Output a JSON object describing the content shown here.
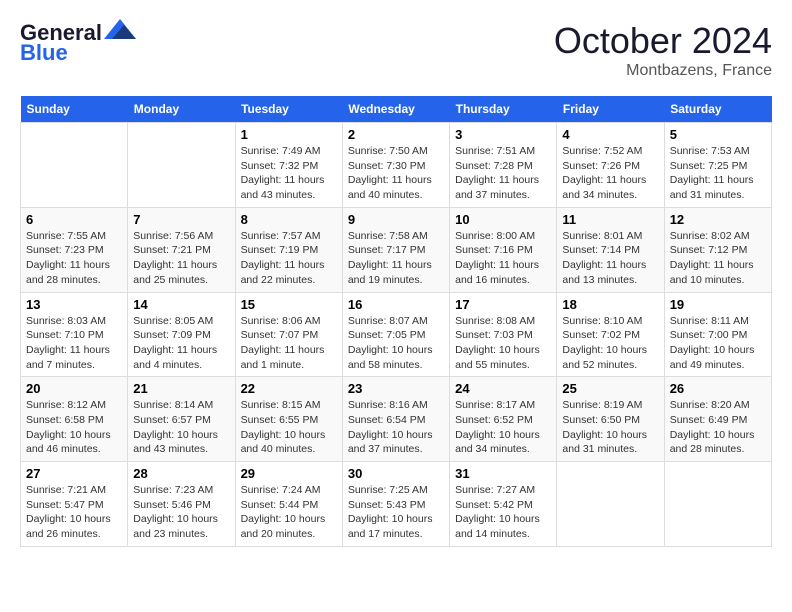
{
  "header": {
    "logo_line1": "General",
    "logo_line2": "Blue",
    "month": "October 2024",
    "location": "Montbazens, France"
  },
  "weekdays": [
    "Sunday",
    "Monday",
    "Tuesday",
    "Wednesday",
    "Thursday",
    "Friday",
    "Saturday"
  ],
  "weeks": [
    [
      {
        "day": "",
        "info": ""
      },
      {
        "day": "",
        "info": ""
      },
      {
        "day": "1",
        "info": "Sunrise: 7:49 AM\nSunset: 7:32 PM\nDaylight: 11 hours and 43 minutes."
      },
      {
        "day": "2",
        "info": "Sunrise: 7:50 AM\nSunset: 7:30 PM\nDaylight: 11 hours and 40 minutes."
      },
      {
        "day": "3",
        "info": "Sunrise: 7:51 AM\nSunset: 7:28 PM\nDaylight: 11 hours and 37 minutes."
      },
      {
        "day": "4",
        "info": "Sunrise: 7:52 AM\nSunset: 7:26 PM\nDaylight: 11 hours and 34 minutes."
      },
      {
        "day": "5",
        "info": "Sunrise: 7:53 AM\nSunset: 7:25 PM\nDaylight: 11 hours and 31 minutes."
      }
    ],
    [
      {
        "day": "6",
        "info": "Sunrise: 7:55 AM\nSunset: 7:23 PM\nDaylight: 11 hours and 28 minutes."
      },
      {
        "day": "7",
        "info": "Sunrise: 7:56 AM\nSunset: 7:21 PM\nDaylight: 11 hours and 25 minutes."
      },
      {
        "day": "8",
        "info": "Sunrise: 7:57 AM\nSunset: 7:19 PM\nDaylight: 11 hours and 22 minutes."
      },
      {
        "day": "9",
        "info": "Sunrise: 7:58 AM\nSunset: 7:17 PM\nDaylight: 11 hours and 19 minutes."
      },
      {
        "day": "10",
        "info": "Sunrise: 8:00 AM\nSunset: 7:16 PM\nDaylight: 11 hours and 16 minutes."
      },
      {
        "day": "11",
        "info": "Sunrise: 8:01 AM\nSunset: 7:14 PM\nDaylight: 11 hours and 13 minutes."
      },
      {
        "day": "12",
        "info": "Sunrise: 8:02 AM\nSunset: 7:12 PM\nDaylight: 11 hours and 10 minutes."
      }
    ],
    [
      {
        "day": "13",
        "info": "Sunrise: 8:03 AM\nSunset: 7:10 PM\nDaylight: 11 hours and 7 minutes."
      },
      {
        "day": "14",
        "info": "Sunrise: 8:05 AM\nSunset: 7:09 PM\nDaylight: 11 hours and 4 minutes."
      },
      {
        "day": "15",
        "info": "Sunrise: 8:06 AM\nSunset: 7:07 PM\nDaylight: 11 hours and 1 minute."
      },
      {
        "day": "16",
        "info": "Sunrise: 8:07 AM\nSunset: 7:05 PM\nDaylight: 10 hours and 58 minutes."
      },
      {
        "day": "17",
        "info": "Sunrise: 8:08 AM\nSunset: 7:03 PM\nDaylight: 10 hours and 55 minutes."
      },
      {
        "day": "18",
        "info": "Sunrise: 8:10 AM\nSunset: 7:02 PM\nDaylight: 10 hours and 52 minutes."
      },
      {
        "day": "19",
        "info": "Sunrise: 8:11 AM\nSunset: 7:00 PM\nDaylight: 10 hours and 49 minutes."
      }
    ],
    [
      {
        "day": "20",
        "info": "Sunrise: 8:12 AM\nSunset: 6:58 PM\nDaylight: 10 hours and 46 minutes."
      },
      {
        "day": "21",
        "info": "Sunrise: 8:14 AM\nSunset: 6:57 PM\nDaylight: 10 hours and 43 minutes."
      },
      {
        "day": "22",
        "info": "Sunrise: 8:15 AM\nSunset: 6:55 PM\nDaylight: 10 hours and 40 minutes."
      },
      {
        "day": "23",
        "info": "Sunrise: 8:16 AM\nSunset: 6:54 PM\nDaylight: 10 hours and 37 minutes."
      },
      {
        "day": "24",
        "info": "Sunrise: 8:17 AM\nSunset: 6:52 PM\nDaylight: 10 hours and 34 minutes."
      },
      {
        "day": "25",
        "info": "Sunrise: 8:19 AM\nSunset: 6:50 PM\nDaylight: 10 hours and 31 minutes."
      },
      {
        "day": "26",
        "info": "Sunrise: 8:20 AM\nSunset: 6:49 PM\nDaylight: 10 hours and 28 minutes."
      }
    ],
    [
      {
        "day": "27",
        "info": "Sunrise: 7:21 AM\nSunset: 5:47 PM\nDaylight: 10 hours and 26 minutes."
      },
      {
        "day": "28",
        "info": "Sunrise: 7:23 AM\nSunset: 5:46 PM\nDaylight: 10 hours and 23 minutes."
      },
      {
        "day": "29",
        "info": "Sunrise: 7:24 AM\nSunset: 5:44 PM\nDaylight: 10 hours and 20 minutes."
      },
      {
        "day": "30",
        "info": "Sunrise: 7:25 AM\nSunset: 5:43 PM\nDaylight: 10 hours and 17 minutes."
      },
      {
        "day": "31",
        "info": "Sunrise: 7:27 AM\nSunset: 5:42 PM\nDaylight: 10 hours and 14 minutes."
      },
      {
        "day": "",
        "info": ""
      },
      {
        "day": "",
        "info": ""
      }
    ]
  ]
}
